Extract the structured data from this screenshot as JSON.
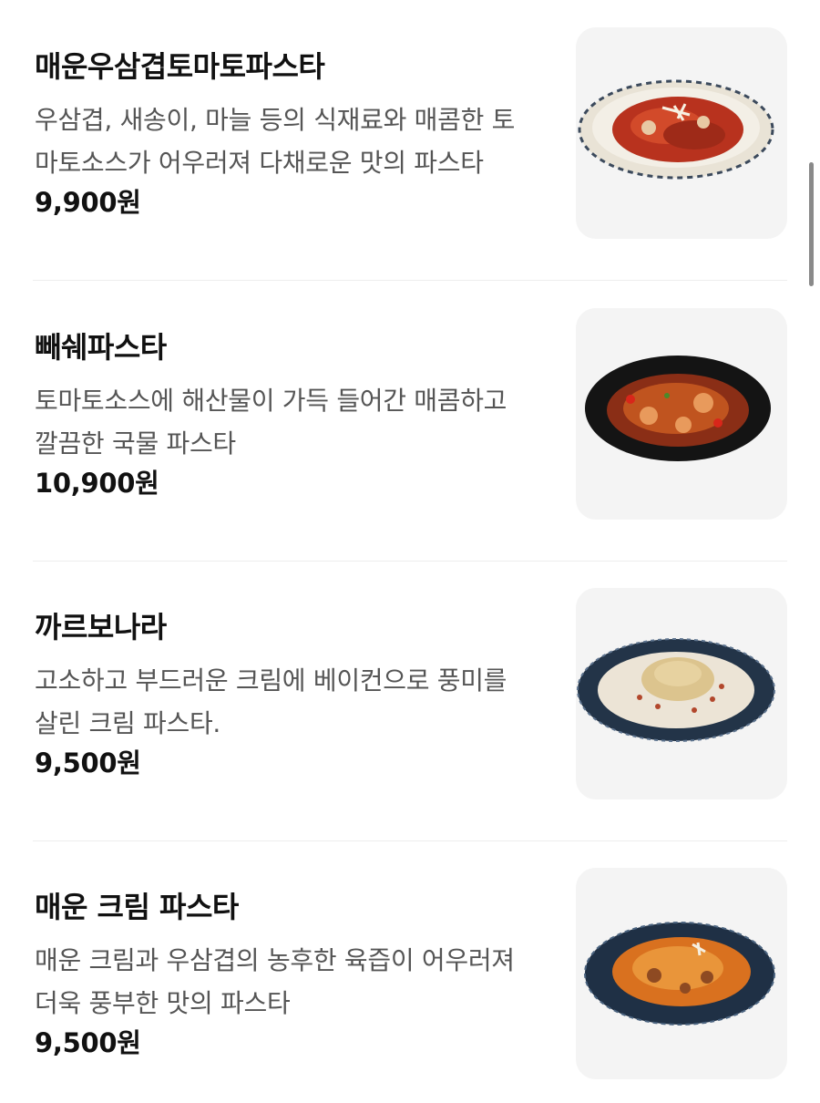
{
  "menu": {
    "items": [
      {
        "name": "매운우삼겹토마토파스타",
        "description": "우삼겹, 새송이, 마늘 등의 식재료와 매콤한 토마토소스가 어우러져 다채로운 맛의 파스타",
        "price": "9,900원",
        "image_icon": "spicy-beef-tomato-pasta-image"
      },
      {
        "name": "빼쉐파스타",
        "description": "토마토소스에 해산물이 가득 들어간 매콤하고 깔끔한 국물 파스타",
        "price": "10,900원",
        "image_icon": "pescatore-pasta-image"
      },
      {
        "name": "까르보나라",
        "description": "고소하고 부드러운 크림에 베이컨으로 풍미를 살린 크림 파스타.",
        "price": "9,500원",
        "image_icon": "carbonara-image"
      },
      {
        "name": "매운 크림 파스타",
        "description": "매운 크림과 우삼겹의 농후한 육즙이 어우러져 더욱 풍부한 맛의 파스타",
        "price": "9,500원",
        "image_icon": "spicy-cream-pasta-image"
      }
    ]
  },
  "colors": {
    "text_primary": "#111111",
    "text_secondary": "#555555",
    "divider": "#eeeeee",
    "thumb_bg": "#f4f4f4",
    "scrollbar": "#8a8a8a"
  }
}
